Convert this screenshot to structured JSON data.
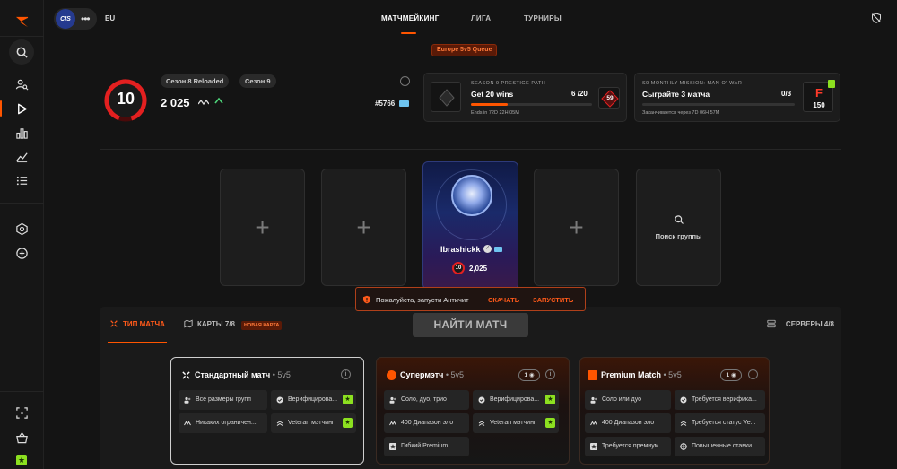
{
  "topbar": {
    "region": "EU",
    "tabs": [
      "МАТЧМЕЙКИНГ",
      "ЛИГА",
      "ТУРНИРЫ"
    ],
    "logo_text": "CIS"
  },
  "queue": {
    "label": "Europe 5v5 Queue"
  },
  "profile": {
    "level": "10",
    "seasons": [
      "Сезон 8 Reloaded",
      "Сезон 9"
    ],
    "elo": "2 025",
    "rank": "#5766"
  },
  "prestige": {
    "subtitle": "SEASON 9 PRESTIGE PATH",
    "title": "Get 20 wins",
    "progress_current": "6",
    "progress_total": "/20",
    "ends": "Ends in 72D 22H 05M",
    "badge": "59",
    "progress_fraction": 0.3
  },
  "mission": {
    "subtitle": "S9 MONTHLY MISSION: MAN-O'-WAR",
    "title": "Сыграйте 3 матча",
    "progress_current": "0",
    "progress_total": "/3",
    "ends": "Заканчивается через 7D 06H 57M",
    "reward_letter": "F",
    "reward_value": "150"
  },
  "party": {
    "player_name": "Ibrashickk",
    "player_level": "10",
    "player_elo": "2,025",
    "search_label": "Поиск группы"
  },
  "anticheat": {
    "message": "Пожалуйста, запусти Античит",
    "download": "СКАЧАТЬ",
    "launch": "ЗАПУСТИТЬ"
  },
  "bottom": {
    "tab_match_type": "ТИП МАТЧА",
    "tab_maps": "КАРТЫ 7/8",
    "new_map_badge": "НОВАЯ КАРТА",
    "find_match": "НАЙТИ МАТЧ",
    "servers": "СЕРВЕРЫ 4/8"
  },
  "match_types": [
    {
      "title": "Стандартный матч",
      "mode": " • 5v5",
      "features": [
        {
          "text": "Все размеры групп",
          "check": true
        },
        {
          "text": "Верифицирова...",
          "check": true
        },
        {
          "text": "Никаких ограничен...",
          "check": false
        },
        {
          "text": "Veteran мэтчинг",
          "check": true
        }
      ]
    },
    {
      "title": "Супермэтч",
      "mode": " • 5v5",
      "counter": "1",
      "features": [
        {
          "text": "Соло, дуо, трио",
          "check": false
        },
        {
          "text": "Верифицирова...",
          "check": true
        },
        {
          "text": "400 Диапазон эло",
          "check": false
        },
        {
          "text": "Veteran мэтчинг",
          "check": true
        },
        {
          "text": "Гибкий Premium",
          "check": false
        }
      ]
    },
    {
      "title": "Premium Match",
      "mode": " • 5v5",
      "counter": "1",
      "features": [
        {
          "text": "Соло или дуо",
          "check": false
        },
        {
          "text": "Требуется верифика...",
          "check": false
        },
        {
          "text": "400 Диапазон эло",
          "check": false
        },
        {
          "text": "Требуется статус Ve...",
          "check": false
        },
        {
          "text": "Требуется премиум",
          "check": false
        },
        {
          "text": "Повышенные ставки",
          "check": false
        }
      ]
    }
  ],
  "colors": {
    "accent": "#ff5500",
    "green": "#8ce020",
    "level_red": "#e32020"
  }
}
